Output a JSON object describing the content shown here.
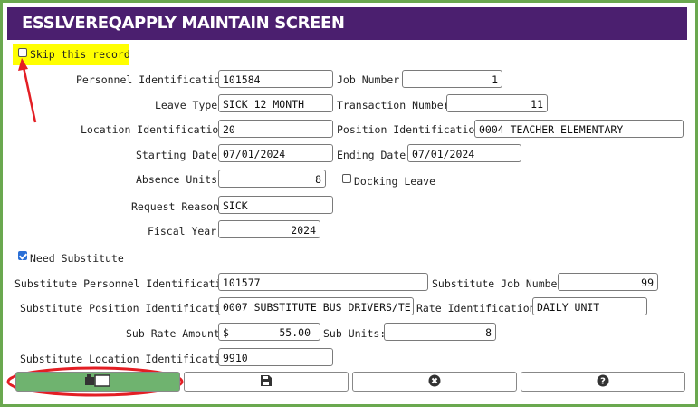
{
  "window": {
    "title": "ESSLVEREQAPPLY MAINTAIN SCREEN"
  },
  "skip": {
    "label": "Skip this record",
    "checked": false
  },
  "fields": {
    "personnel_id": {
      "label": "Personnel Identification:",
      "value": "101584"
    },
    "job_number": {
      "label": "Job Number:",
      "value": "1"
    },
    "leave_type": {
      "label": "Leave Type:",
      "value": "SICK 12 MONTH"
    },
    "transaction_number": {
      "label": "Transaction Number:",
      "value": "11"
    },
    "location_id": {
      "label": "Location Identification:",
      "value": "20"
    },
    "position_id": {
      "label": "Position Identification:",
      "value": "0004 TEACHER ELEMENTARY"
    },
    "starting_date": {
      "label": "Starting Date:",
      "value": "07/01/2024"
    },
    "ending_date": {
      "label": "Ending Date:",
      "value": "07/01/2024"
    },
    "absence_units": {
      "label": "Absence Units:",
      "value": "8"
    },
    "docking_leave": {
      "label": "Docking Leave",
      "checked": false
    },
    "request_reason": {
      "label": "Request Reason:",
      "value": "SICK"
    },
    "fiscal_year": {
      "label": "Fiscal Year:",
      "value": "2024"
    }
  },
  "need_substitute": {
    "label": "Need Substitute",
    "checked": true
  },
  "substitute": {
    "personnel_id": {
      "label": "Substitute Personnel Identification:",
      "value": "101577"
    },
    "job_number": {
      "label": "Substitute Job Number:",
      "value": "99"
    },
    "position_id": {
      "label": "Substitute Position Identification:",
      "value": "0007 SUBSTITUTE BUS DRIVERS/TE"
    },
    "rate_id": {
      "label": "Rate Identification:",
      "value": "DAILY UNIT"
    },
    "sub_rate_amount": {
      "label": "Sub Rate Amount:",
      "currency": "$",
      "value": "55.00"
    },
    "sub_units": {
      "label": "Sub Units:",
      "value": "8"
    },
    "location_id": {
      "label": "Substitute Location Identification:",
      "value": "9910"
    }
  },
  "toolbar": {
    "buttons": [
      {
        "icon": "apply-screen-icon"
      },
      {
        "icon": "save-icon"
      },
      {
        "icon": "cancel-icon"
      },
      {
        "icon": "help-icon"
      }
    ]
  },
  "colors": {
    "title_bar": "#4b1f6f",
    "frame": "#6aa84f",
    "highlight": "#ffff00",
    "annotation": "#e31e24",
    "apply_button": "#6fb36f"
  }
}
